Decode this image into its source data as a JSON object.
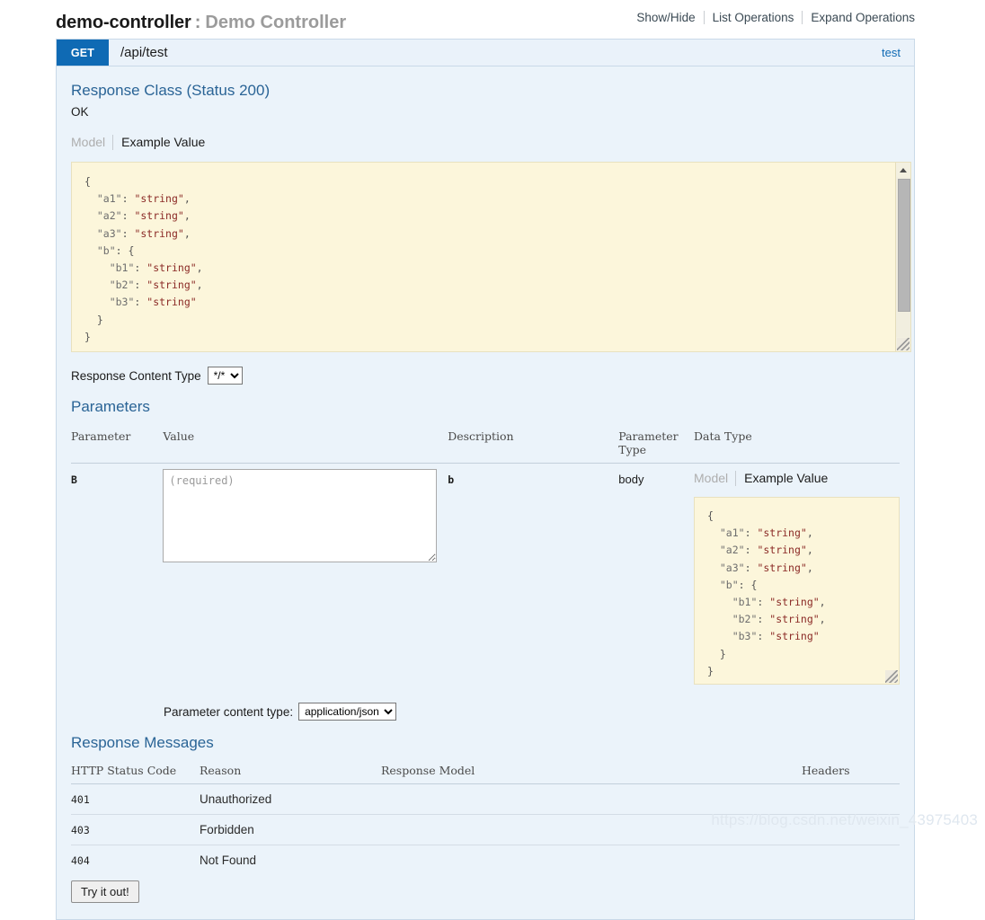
{
  "resource": {
    "name": "demo-controller",
    "separator": ":",
    "description": "Demo Controller",
    "options": [
      {
        "label": "Show/Hide"
      },
      {
        "label": "List Operations"
      },
      {
        "label": "Expand Operations"
      }
    ]
  },
  "operation": {
    "method": "GET",
    "path": "/api/test",
    "summary": "test",
    "response_class": {
      "heading": "Response Class (Status 200)",
      "status_text": "OK",
      "toggle_model": "Model",
      "toggle_example": "Example Value",
      "example_value": "{\n  \"a1\": \"string\",\n  \"a2\": \"string\",\n  \"a3\": \"string\",\n  \"b\": {\n    \"b1\": \"string\",\n    \"b2\": \"string\",\n    \"b3\": \"string\"\n  }\n}"
    },
    "response_content_type": {
      "label": "Response Content Type",
      "selected": "*/*",
      "options": [
        "*/*"
      ]
    },
    "parameters": {
      "heading": "Parameters",
      "columns": [
        "Parameter",
        "Value",
        "Description",
        "Parameter Type",
        "Data Type"
      ],
      "rows": [
        {
          "parameter": "B",
          "value_placeholder": "(required)",
          "value": "",
          "description": "b",
          "parameter_type": "body",
          "data_type": {
            "toggle_model": "Model",
            "toggle_example": "Example Value",
            "example_value": "{\n  \"a1\": \"string\",\n  \"a2\": \"string\",\n  \"a3\": \"string\",\n  \"b\": {\n    \"b1\": \"string\",\n    \"b2\": \"string\",\n    \"b3\": \"string\"\n  }\n}"
          }
        }
      ],
      "content_type": {
        "label": "Parameter content type:",
        "selected": "application/json",
        "options": [
          "application/json"
        ]
      }
    },
    "response_messages": {
      "heading": "Response Messages",
      "columns": [
        "HTTP Status Code",
        "Reason",
        "Response Model",
        "Headers"
      ],
      "rows": [
        {
          "code": "401",
          "reason": "Unauthorized",
          "model": "",
          "headers": ""
        },
        {
          "code": "403",
          "reason": "Forbidden",
          "model": "",
          "headers": ""
        },
        {
          "code": "404",
          "reason": "Not Found",
          "model": "",
          "headers": ""
        }
      ]
    },
    "try_it_out_label": "Try it out!"
  },
  "watermark": "https://blog.csdn.net/weixin_43975403",
  "colors": {
    "method_get": "#0f6ab4",
    "panel_bg": "#ebf3fa",
    "panel_border": "#c9d9e8",
    "code_bg": "#fcf6db",
    "heading_link": "#2a6496"
  }
}
